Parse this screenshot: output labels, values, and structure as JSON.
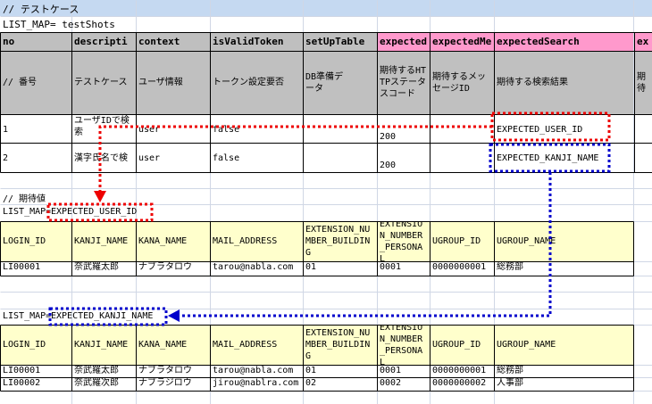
{
  "colors": {
    "title_row_bg": "#c5d9f1",
    "header_gray": "#bfbfbf",
    "header_pink": "#ff99cc",
    "header_yellow": "#ffffcc",
    "desc_gray": "#c0c0c0",
    "red_marker": "#ee0000",
    "blue_marker": "#0000cc"
  },
  "title": "// テストケース",
  "list_map_label": "LIST_MAP= testShots",
  "test_table": {
    "headers": [
      "no",
      "descripti",
      "context",
      "isValidToken",
      "setUpTable",
      "expected",
      "expectedMe",
      "expectedSearch",
      "ex"
    ],
    "descriptions": [
      "// 番号",
      "テストケース",
      "ユーザ情報",
      "トークン設定要否",
      "DB準備データ",
      "期待するHTTPステータスコード",
      "期待するメッセージID",
      "期待する検索結果",
      "期待"
    ],
    "rows": [
      {
        "no": "1",
        "desc": "ユーザIDで検索",
        "context": "user",
        "token": "false",
        "setup": "",
        "status": "200",
        "message": "",
        "search": "EXPECTED_USER_ID",
        "extra": ""
      },
      {
        "no": "2",
        "desc": "漢字氏名で検",
        "context": "user",
        "token": "false",
        "setup": "",
        "status": "200",
        "message": "",
        "search": "EXPECTED_KANJI_NAME",
        "extra": ""
      }
    ]
  },
  "expected_title": "// 期待値",
  "map1": {
    "prefix": "LIST_MAP=",
    "name": "EXPECTED_USER_ID"
  },
  "map2": {
    "prefix": "LIST_MAP=",
    "name": "EXPECTED_KANJI_NAME"
  },
  "user_table_headers": [
    "LOGIN_ID",
    "KANJI_NAME",
    "KANA_NAME",
    "MAIL_ADDRESS",
    "EXTENSION_NUMBER_BUILDING",
    "EXTENSION_NUMBER_PERSONAL",
    "UGROUP_ID",
    "UGROUP_NAME"
  ],
  "user_table1_rows": [
    [
      "LI00001",
      "奈武羅太郎",
      "ナブラタロウ",
      "tarou@nabla.com",
      "01",
      "0001",
      "0000000001",
      "総務部"
    ]
  ],
  "user_table2_rows": [
    [
      "LI00001",
      "奈武羅太郎",
      "ナブラタロウ",
      "tarou@nabla.com",
      "01",
      "0001",
      "0000000001",
      "総務部"
    ],
    [
      "LI00002",
      "奈武羅次郎",
      "ナブラジロウ",
      "jirou@nablra.com",
      "02",
      "0002",
      "0000000002",
      "人事部"
    ]
  ]
}
